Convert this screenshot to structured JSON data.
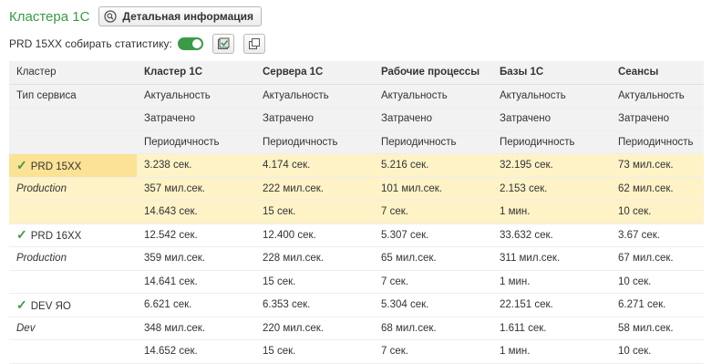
{
  "header": {
    "title": "Кластера 1С",
    "detail_button": "Детальная информация"
  },
  "stats": {
    "label": "PRD 15XX собирать статистику:",
    "toggle_on": true
  },
  "table": {
    "columns": [
      "Кластер",
      "Кластер 1С",
      "Сервера 1С",
      "Рабочие процессы",
      "Базы 1С",
      "Сеансы"
    ],
    "service_header": {
      "label": "Тип сервиса",
      "rows": [
        [
          "Актуальность",
          "Актуальность",
          "Актуальность",
          "Актуальность",
          "Актуальность"
        ],
        [
          "Затрачено",
          "Затрачено",
          "Затрачено",
          "Затрачено",
          "Затрачено"
        ],
        [
          "Периодичность",
          "Периодичность",
          "Периодичность",
          "Периодичность",
          "Периодичность"
        ]
      ]
    },
    "clusters": [
      {
        "name": "PRD 15XX",
        "env": "Production",
        "highlighted": true,
        "rows": [
          [
            "3.238 сек.",
            "4.174 сек.",
            "5.216 сек.",
            "32.195 сек.",
            "73 мил.сек."
          ],
          [
            "357 мил.сек.",
            "222 мил.сек.",
            "101 мил.сек.",
            "2.153 сек.",
            "62 мил.сек."
          ],
          [
            "14.643 сек.",
            "15 сек.",
            "7 сек.",
            "1 мин.",
            "10 сек."
          ]
        ]
      },
      {
        "name": "PRD 16XX",
        "env": "Production",
        "highlighted": false,
        "rows": [
          [
            "12.542 сек.",
            "12.400 сек.",
            "5.307 сек.",
            "33.632 сек.",
            "3.67 сек."
          ],
          [
            "359 мил.сек.",
            "228 мил.сек.",
            "65 мил.сек.",
            "311 мил.сек.",
            "67 мил.сек."
          ],
          [
            "14.641 сек.",
            "15 сек.",
            "7 сек.",
            "1 мин.",
            "10 сек."
          ]
        ]
      },
      {
        "name": "DEV ЯО",
        "env": "Dev",
        "highlighted": false,
        "rows": [
          [
            "6.621 сек.",
            "6.353 сек.",
            "5.304 сек.",
            "22.151 сек.",
            "6.271 сек."
          ],
          [
            "348 мил.сек.",
            "220 мил.сек.",
            "68 мил.сек.",
            "1.611 сек.",
            "58 мил.сек."
          ],
          [
            "14.652 сек.",
            "15 сек.",
            "7 сек.",
            "1 мин.",
            "10 сек."
          ]
        ]
      }
    ]
  }
}
